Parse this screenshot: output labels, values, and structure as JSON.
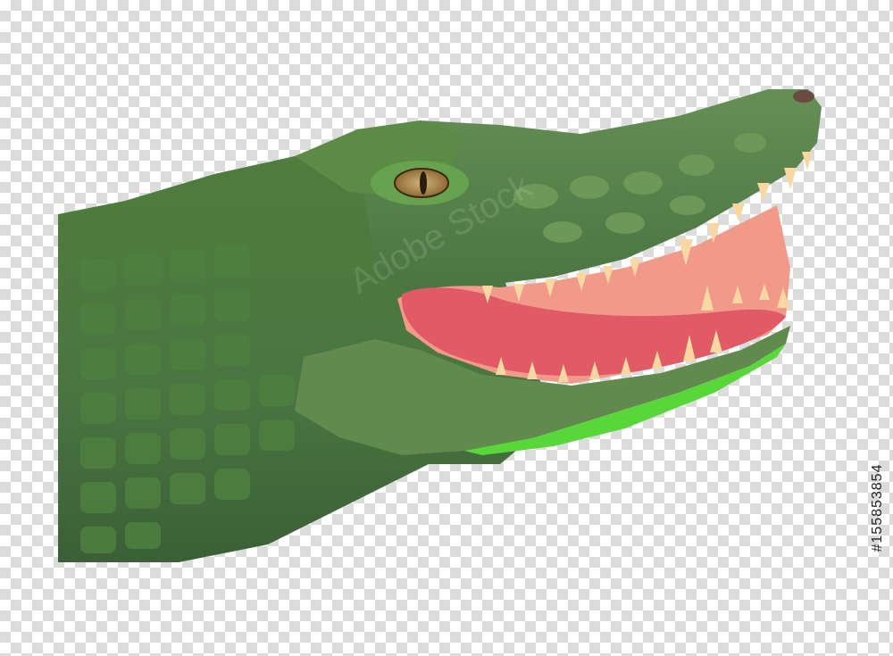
{
  "image": {
    "subject_icon": "crocodile-head",
    "background": "transparent-checkerboard",
    "colors": {
      "skin_dark": "#3f6a34",
      "skin_mid": "#5c8a4a",
      "skin_light": "#79a25f",
      "belly_green": "#58d63a",
      "mouth": "#f29a8a",
      "tongue": "#e05b66",
      "teeth": "#f8d7a2",
      "eye": "#c19a56"
    }
  },
  "watermark_text": "Adobe Stock",
  "stock_id": "#155853854"
}
